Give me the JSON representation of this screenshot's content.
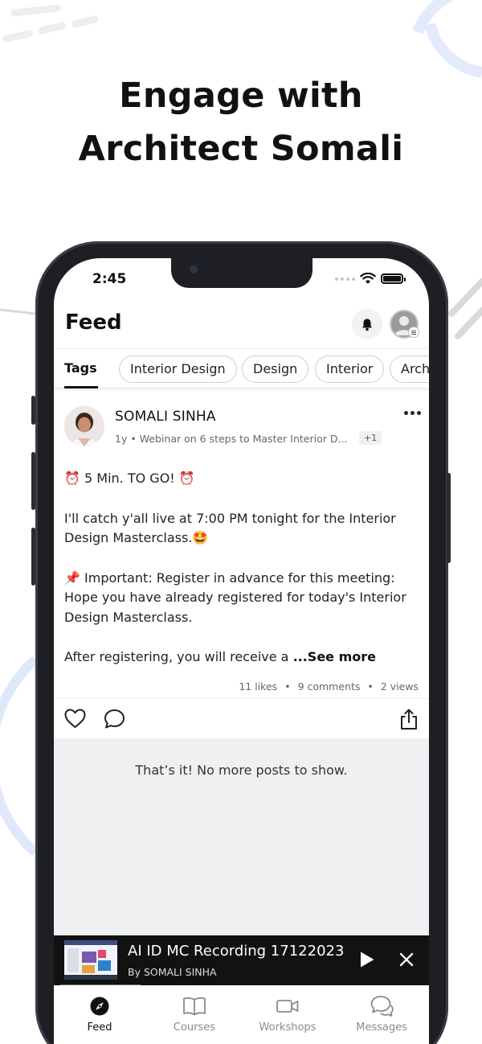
{
  "headline": {
    "line1": "Engage with",
    "line2": "Architect Somali"
  },
  "status_bar": {
    "time": "2:45"
  },
  "header": {
    "title": "Feed"
  },
  "tags": {
    "label": "Tags",
    "chips": [
      "Interior Design",
      "Design",
      "Interior",
      "Arch"
    ]
  },
  "post": {
    "author": "SOMALI SINHA",
    "meta": "1y  •  Webinar on 6 steps to Master  Interior D...",
    "extra_badge": "+1",
    "line1": "⏰ 5 Min. TO GO! ⏰",
    "line2": "I'll catch y'all live at 7:00 PM tonight for the Interior Design Masterclass.🤩",
    "line3": "📌 Important: Register in advance for this meeting: Hope you have already registered for today's Interior Design Masterclass.",
    "line4": "After registering, you will receive a ",
    "see_more": "...See more",
    "likes": "11 likes",
    "comments": "9 comments",
    "views": "2 views"
  },
  "end_message": "That’s it! No more posts to show.",
  "mini_player": {
    "title": "AI ID MC Recording 17122023",
    "subtitle": "By SOMALI SINHA"
  },
  "tabbar": {
    "items": [
      {
        "label": "Feed",
        "icon": "compass-icon",
        "active": true
      },
      {
        "label": "Courses",
        "icon": "book-icon",
        "active": false
      },
      {
        "label": "Workshops",
        "icon": "video-camera-icon",
        "active": false
      },
      {
        "label": "Messages",
        "icon": "chat-bubbles-icon",
        "active": false
      }
    ]
  },
  "colors": {
    "accent_decoration": "#dfe7fb",
    "player_bg": "#121212",
    "end_area_bg": "#eff0f2",
    "phone_frame": "#1d1f24"
  }
}
